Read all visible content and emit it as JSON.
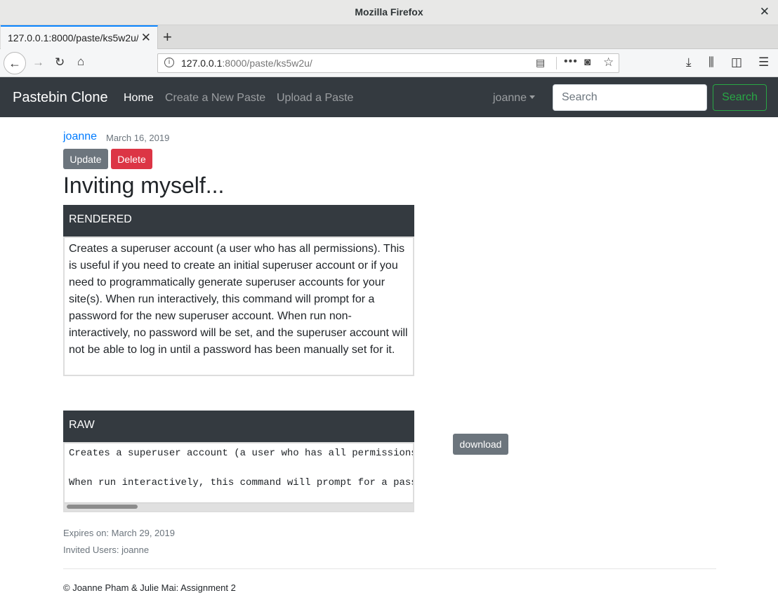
{
  "browser": {
    "window_title": "Mozilla Firefox",
    "tab_label": "127.0.0.1:8000/paste/ks5w2u/",
    "url_host": "127.0.0.1",
    "url_rest": ":8000/paste/ks5w2u/"
  },
  "nav": {
    "brand": "Pastebin Clone",
    "links": [
      "Home",
      "Create a New Paste",
      "Upload a Paste"
    ],
    "user": "joanne",
    "search_placeholder": "Search",
    "search_button": "Search"
  },
  "paste": {
    "author": "joanne",
    "date": "March 16, 2019",
    "update_label": "Update",
    "delete_label": "Delete",
    "title": "Inviting myself...",
    "rendered_header": "RENDERED",
    "rendered_text": "Creates a superuser account (a user who has all permissions). This is useful if you need to create an initial superuser account or if you need to programmatically generate superuser accounts for your site(s). When run interactively, this command will prompt for a password for the new superuser account. When run non-interactively, no password will be set, and the superuser account will not be able to log in until a password has been manually set for it.",
    "raw_header": "RAW",
    "raw_line1": "Creates a superuser account (a user who has all permissions).",
    "raw_line2": "When run interactively, this command will prompt for a passwor",
    "download_label": "download",
    "expires": "Expires on: March 29, 2019",
    "invited": "Invited Users: joanne"
  },
  "footer": "© Joanne Pham & Julie Mai: Assignment 2"
}
